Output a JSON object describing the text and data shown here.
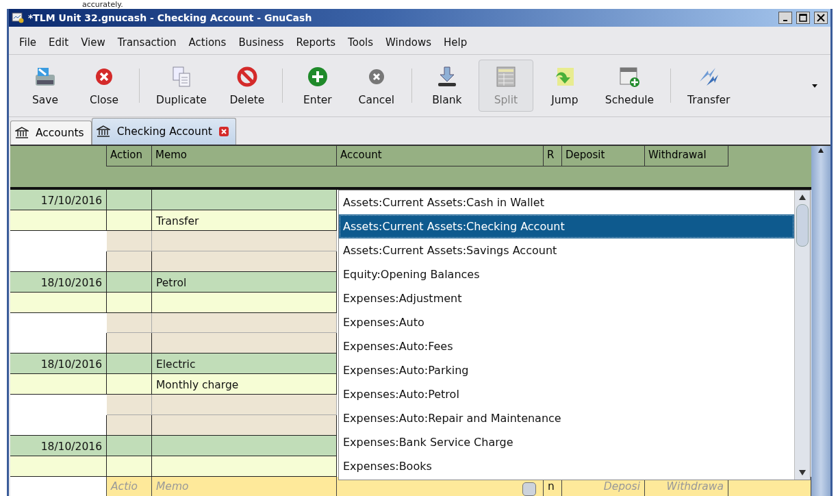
{
  "page_caption": "accurately.",
  "window": {
    "title": "*TLM Unit 32.gnucash - Checking Account - GnuCash"
  },
  "menu": [
    "File",
    "Edit",
    "View",
    "Transaction",
    "Actions",
    "Business",
    "Reports",
    "Tools",
    "Windows",
    "Help"
  ],
  "toolbar": [
    {
      "kind": "save",
      "label": "Save",
      "pressed": false
    },
    {
      "kind": "close",
      "label": "Close",
      "pressed": false
    },
    {
      "kind": "separator"
    },
    {
      "kind": "duplicate",
      "label": "Duplicate",
      "pressed": false
    },
    {
      "kind": "delete",
      "label": "Delete",
      "pressed": false
    },
    {
      "kind": "separator"
    },
    {
      "kind": "enter",
      "label": "Enter",
      "pressed": false
    },
    {
      "kind": "cancel",
      "label": "Cancel",
      "pressed": false
    },
    {
      "kind": "separator"
    },
    {
      "kind": "blank",
      "label": "Blank",
      "pressed": false
    },
    {
      "kind": "split",
      "label": "Split",
      "pressed": true
    },
    {
      "kind": "jump",
      "label": "Jump",
      "pressed": false
    },
    {
      "kind": "schedule",
      "label": "Schedule",
      "pressed": false
    },
    {
      "kind": "separator"
    },
    {
      "kind": "transfer",
      "label": "Transfer",
      "pressed": false
    }
  ],
  "tabs": [
    {
      "label": "Accounts",
      "selected": false
    },
    {
      "label": "Checking Account",
      "selected": true
    }
  ],
  "register": {
    "columns": [
      "Action",
      "Memo",
      "Account",
      "R",
      "Deposit",
      "Withdrawal"
    ],
    "transactions": [
      {
        "date": "17/10/2016",
        "notes": "Transfer",
        "expanded": true
      },
      {
        "date": "18/10/2016",
        "description": "Petrol",
        "expanded": true
      },
      {
        "date": "18/10/2016",
        "description": "Electric",
        "notes": "Monthly charge",
        "expanded": true
      },
      {
        "date": "18/10/2016",
        "expanded": false
      }
    ],
    "blank_entry": {
      "action_placeholder": "Actio",
      "memo_placeholder": "Memo",
      "reconcile": "n",
      "deposit_placeholder": "Deposi",
      "withdrawal_placeholder": "Withdrawa"
    },
    "account_dropdown": [
      {
        "label": "Assets:Current Assets:Cash in Wallet",
        "selected": false
      },
      {
        "label": "Assets:Current Assets:Checking Account",
        "selected": true
      },
      {
        "label": "Assets:Current Assets:Savings Account",
        "selected": false
      },
      {
        "label": "Equity:Opening Balances",
        "selected": false
      },
      {
        "label": "Expenses:Adjustment",
        "selected": false
      },
      {
        "label": "Expenses:Auto",
        "selected": false
      },
      {
        "label": "Expenses:Auto:Fees",
        "selected": false
      },
      {
        "label": "Expenses:Auto:Parking",
        "selected": false
      },
      {
        "label": "Expenses:Auto:Petrol",
        "selected": false
      },
      {
        "label": "Expenses:Auto:Repair and Maintenance",
        "selected": false
      },
      {
        "label": "Expenses:Bank Service Charge",
        "selected": false
      },
      {
        "label": "Expenses:Books",
        "selected": false
      }
    ]
  }
}
